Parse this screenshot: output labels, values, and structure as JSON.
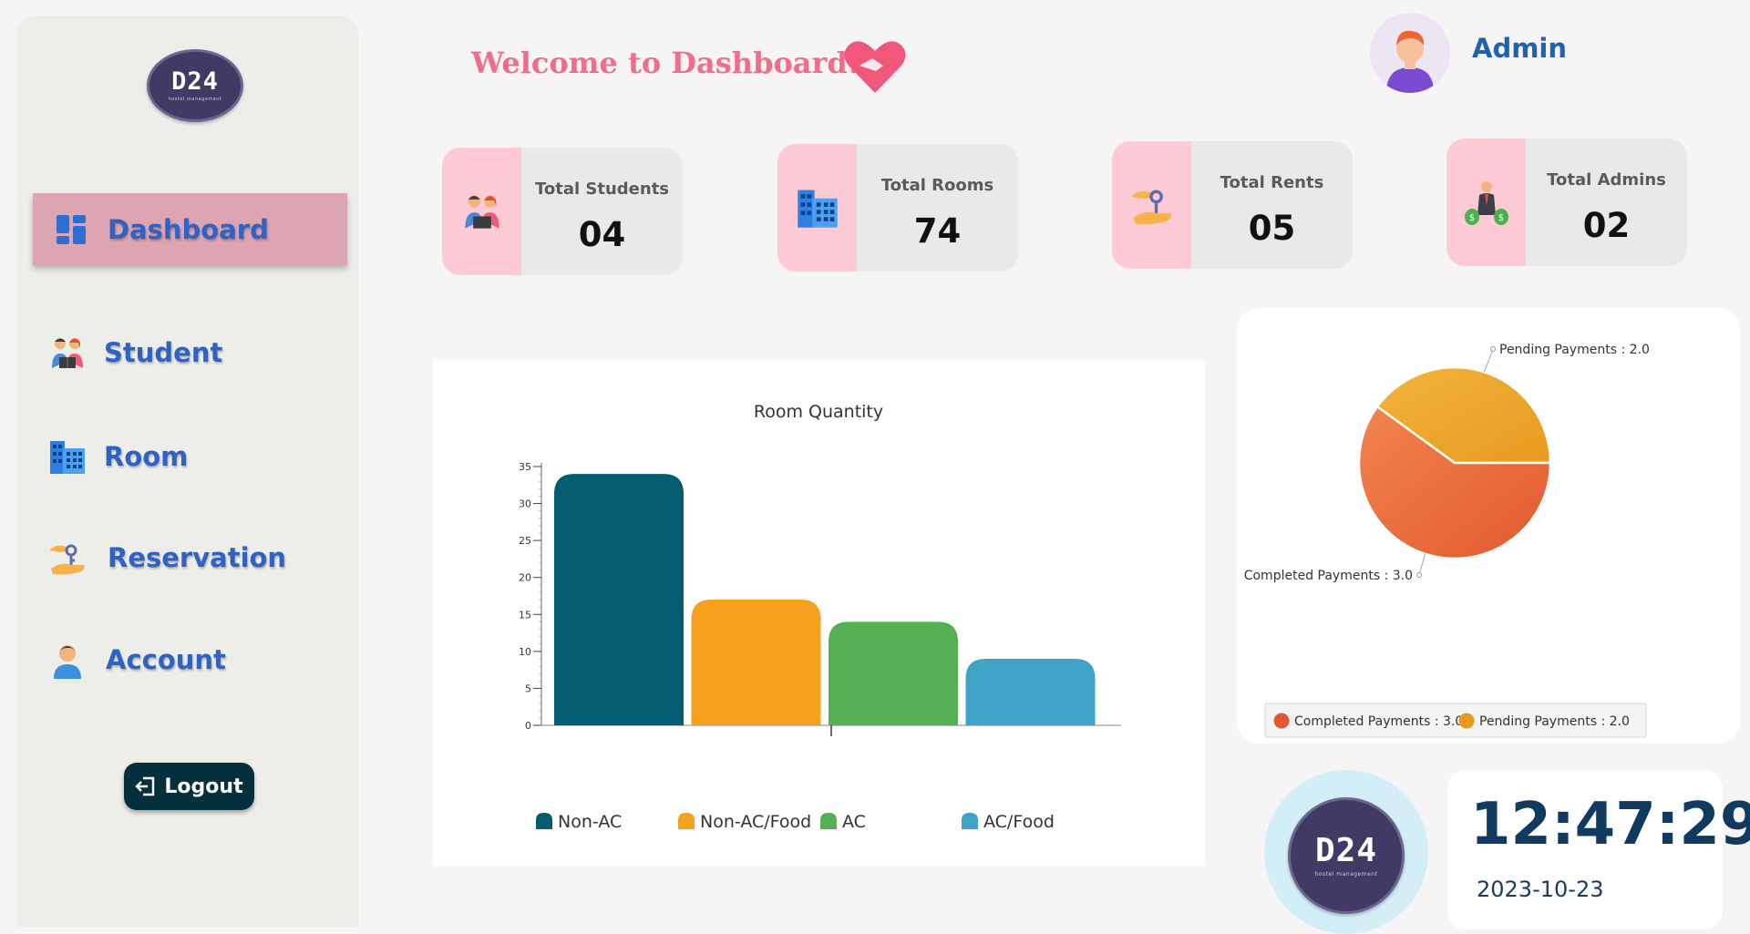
{
  "logo": {
    "text": "D24",
    "subtitle": "hostel management"
  },
  "sidebar": {
    "items": [
      {
        "label": "Dashboard",
        "icon": "dashboard-icon",
        "active": true
      },
      {
        "label": "Student",
        "icon": "students-icon",
        "active": false
      },
      {
        "label": "Room",
        "icon": "building-icon",
        "active": false
      },
      {
        "label": "Reservation",
        "icon": "key-hand-icon",
        "active": false
      },
      {
        "label": "Account",
        "icon": "user-icon",
        "active": false
      }
    ],
    "logout_label": "Logout"
  },
  "header": {
    "welcome": "Welcome to Dashboard!",
    "admin_name": "Admin"
  },
  "cards": [
    {
      "label": "Total Students",
      "value": "04",
      "icon": "students-icon"
    },
    {
      "label": "Total Rooms",
      "value": "74",
      "icon": "building-icon"
    },
    {
      "label": "Total Rents",
      "value": "05",
      "icon": "key-hand-icon"
    },
    {
      "label": "Total Admins",
      "value": "02",
      "icon": "businessman-icon"
    }
  ],
  "clock": {
    "time": "12:47:29",
    "date": "2023-10-23"
  },
  "colors": {
    "accent_pink": "#ef6d8d",
    "nav_blue": "#2e63c4",
    "active_bg": "#dda5b1",
    "card_icon_bg": "#fdcad6",
    "logout_bg": "#062f3d"
  },
  "chart_data": [
    {
      "type": "bar",
      "title": "Room Quantity",
      "categories": [
        "Non-AC",
        "Non-AC/Food",
        "AC",
        "AC/Food"
      ],
      "values": [
        34,
        17,
        14,
        9
      ],
      "colors": [
        "#035c6f",
        "#f5a11e",
        "#54b052",
        "#3ea3c6"
      ],
      "ylim": [
        0,
        35
      ],
      "yticks": [
        0,
        5,
        10,
        15,
        20,
        25,
        30,
        35
      ],
      "legend": [
        "Non-AC",
        "Non-AC/Food",
        "AC",
        "AC/Food"
      ],
      "legend_position": "bottom"
    },
    {
      "type": "pie",
      "slices": [
        {
          "label": "Completed Payments : 3.0",
          "value": 3.0,
          "color": "#e2592f"
        },
        {
          "label": "Pending Payments : 2.0",
          "value": 2.0,
          "color": "#e79a1f"
        }
      ],
      "legend": [
        "Completed Payments : 3.0",
        "Pending Payments : 2.0"
      ],
      "legend_position": "bottom"
    }
  ]
}
